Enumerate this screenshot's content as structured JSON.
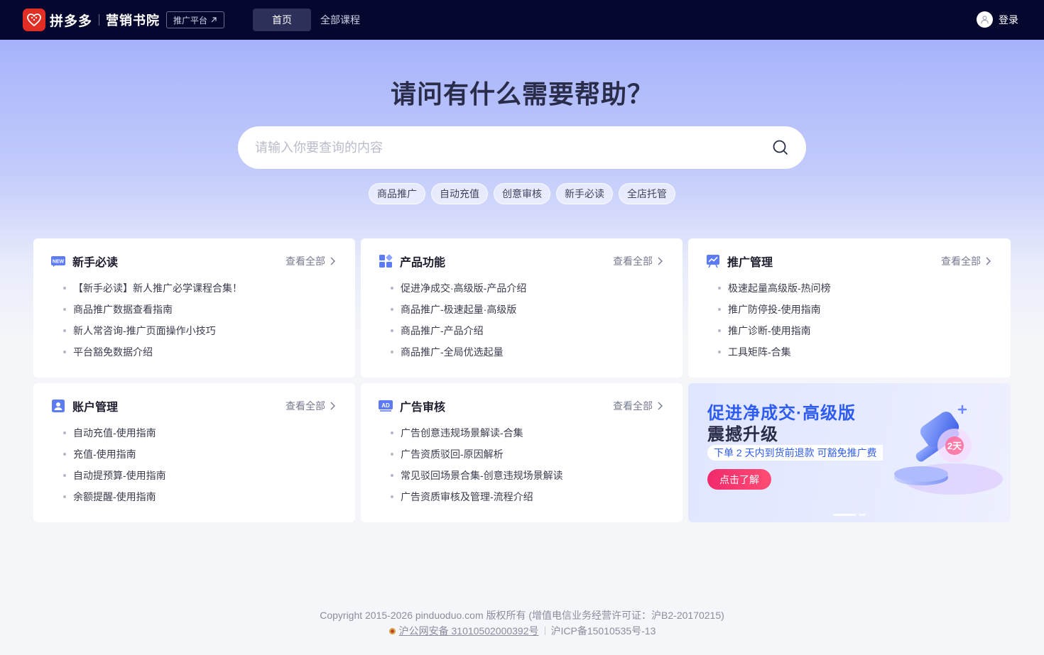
{
  "header": {
    "brand": "拼多多",
    "academy": "营销书院",
    "promo_link": "推广平台",
    "nav": [
      "首页",
      "全部课程"
    ],
    "login": "登录"
  },
  "hero": {
    "title": "请问有什么需要帮助？",
    "search_placeholder": "请输入你要查询的内容",
    "tags": [
      "商品推广",
      "自动充值",
      "创意审核",
      "新手必读",
      "全店托管"
    ]
  },
  "cards": [
    {
      "icon": "new-badge-icon",
      "title": "新手必读",
      "more": "查看全部",
      "items": [
        "【新手必读】新人推广必学课程合集！",
        "商品推广数据查看指南",
        "新人常咨询-推广页面操作小技巧",
        "平台豁免数据介绍"
      ]
    },
    {
      "icon": "apps-grid-icon",
      "title": "产品功能",
      "more": "查看全部",
      "items": [
        "促进净成交·高级版-产品介绍",
        "商品推广-极速起量·高级版",
        "商品推广-产品介绍",
        "商品推广-全局优选起量"
      ]
    },
    {
      "icon": "chart-trend-icon",
      "title": "推广管理",
      "more": "查看全部",
      "items": [
        "极速起量高级版-热问榜",
        "推广防停投-使用指南",
        "推广诊断-使用指南",
        "工具矩阵-合集"
      ]
    },
    {
      "icon": "user-card-icon",
      "title": "账户管理",
      "more": "查看全部",
      "items": [
        "自动充值-使用指南",
        "充值-使用指南",
        "自动提预算-使用指南",
        "余额提醒-使用指南"
      ]
    },
    {
      "icon": "ad-badge-icon",
      "title": "广告审核",
      "more": "查看全部",
      "items": [
        "广告创意违规场景解读-合集",
        "广告资质驳回-原因解析",
        "常见驳回场景合集-创意违规场景解读",
        "广告资质审核及管理-流程介绍"
      ]
    }
  ],
  "banner": {
    "title_line1": "促进净成交·高级版",
    "title_line2": "震撼升级",
    "subtitle": "下单 2 天内到货前退款 可豁免推广费",
    "button": "点击了解",
    "art_label": "2天"
  },
  "footer": {
    "copyright": "Copyright 2015-2026 pinduoduo.com 版权所有 (增值电信业务经营许可证：沪B2-20170215)",
    "police": "沪公网安备 31010502000392号",
    "icp": "沪ICP备15010535号-13"
  },
  "colors": {
    "header_bg": "#05072e",
    "brand_red": "#e02e24",
    "accent_blue": "#2f5cf0",
    "banner_button": "#f02a6c"
  }
}
